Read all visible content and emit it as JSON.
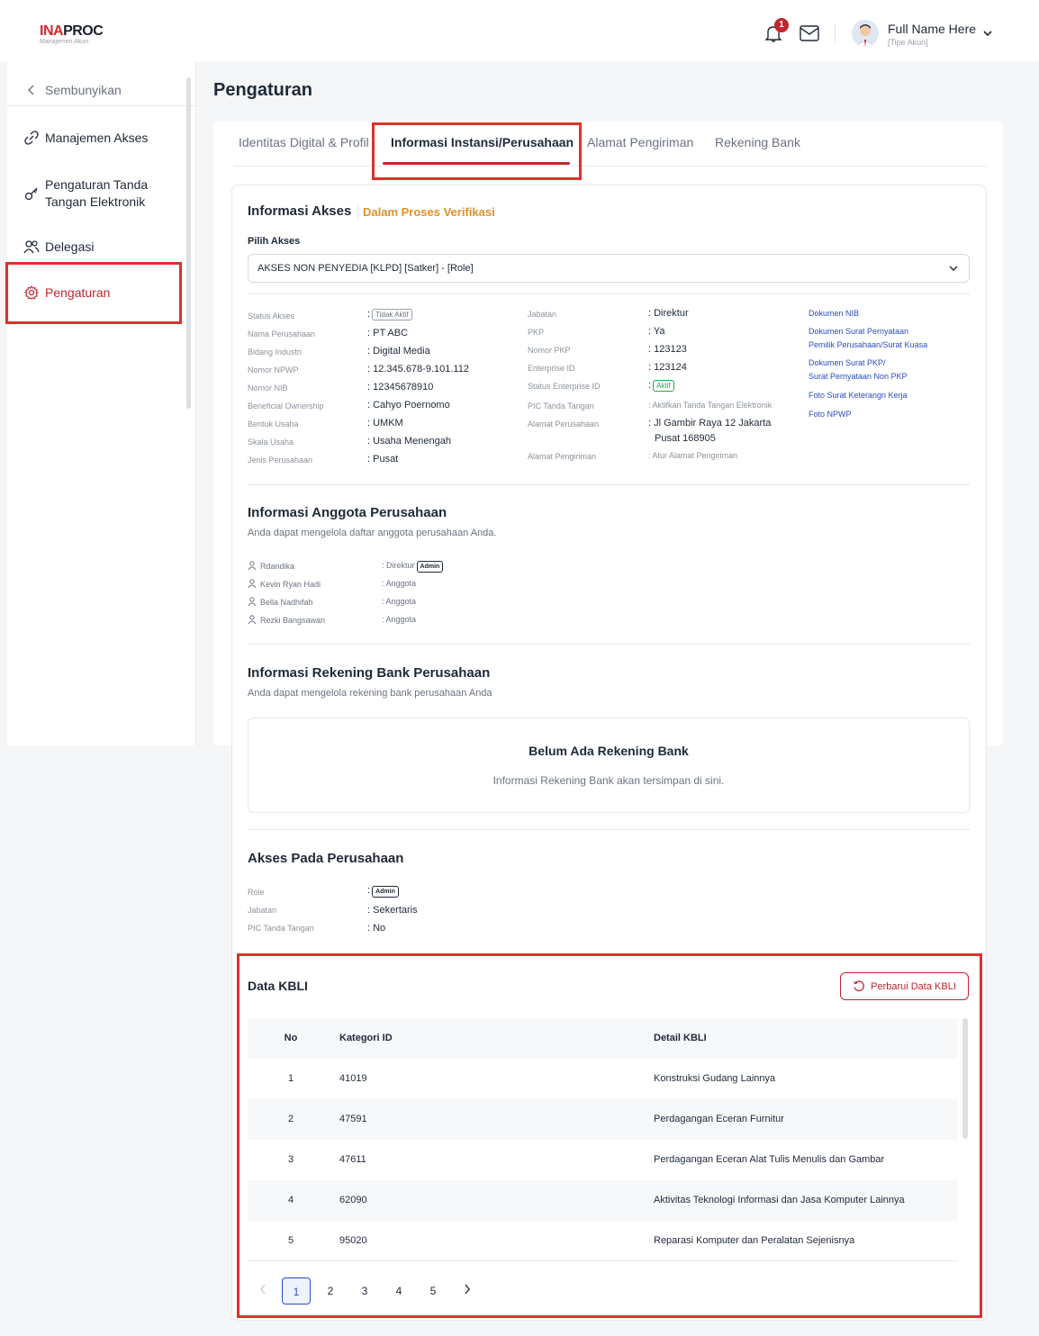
{
  "header": {
    "logo_prefix": "INA",
    "logo_suffix": "PROC",
    "logo_sub": "Manajemen Akun",
    "notif_count": "1",
    "user_name": "Full Name Here",
    "user_role": "[Tipe Akun]"
  },
  "sidebar": {
    "hide_label": "Sembunyikan",
    "items": [
      {
        "label": "Manajemen Akses"
      },
      {
        "label": "Pengaturan Tanda"
      },
      {
        "label": "Tangan Elektronik"
      },
      {
        "label": "Delegasi"
      },
      {
        "label": "Pengaturan"
      }
    ]
  },
  "page": {
    "title": "Pengaturan",
    "tabs": [
      "Identitas Digital & Profil",
      "Informasi Instansi/Perusahaan",
      "Alamat Pengiriman",
      "Rekening Bank"
    ]
  },
  "akses": {
    "title": "Informasi Akses",
    "status": "Dalam Proses Verifikasi",
    "pilih_label": "Pilih Akses",
    "selected": "AKSES NON PENYEDIA [KLPD] [Satker] - [Role]",
    "col1_labels": [
      "Status Akses",
      "Nama Perusahaan",
      "Bidang Industri",
      "Nomor NPWP",
      "Nomor NIB",
      "Beneficial Ownership",
      "Bentuk Usaha",
      "Skala Usaha",
      "Jenis Perusahaan"
    ],
    "col1_values": [
      ":",
      ": PT ABC",
      ": Digital Media",
      ": 12.345.678-9.101.112",
      ": 12345678910",
      ": Cahyo Poernomo",
      ": UMKM",
      ": Usaha Menengah",
      ": Pusat"
    ],
    "status_pill": "Tidak Aktif",
    "col2_labels": [
      "Jabatan",
      "PKP",
      "Nomor PKP",
      "Enterprise ID",
      "Status Enterprise ID",
      "PIC Tanda Tangan",
      "Alamat Perusahaan",
      "Alamat Pengiriman"
    ],
    "col2_values": [
      ": Direktur",
      ": Ya",
      ": 123123",
      ": 123124",
      ":",
      ": Aktifkan Tanda Tangan Elektronik",
      ": Jl Gambir Raya 12 Jakarta",
      "Pusat 168905",
      ": Atur Alamat Pengiriman"
    ],
    "enterprise_pill": "Aktif",
    "docs": [
      "Dokumen NIB",
      "Dokumen Surat Pernyataan",
      "Pemilik Perusahaan/Surat Kuasa",
      "Dokumen Surat PKP/",
      "Surat Pernyataan Non PKP",
      "Foto Surat Keterangn Kerja",
      "Foto NPWP"
    ]
  },
  "anggota": {
    "title": "Informasi Anggota Perusahaan",
    "subtitle": "Anda dapat mengelola daftar anggota perusahaan Anda.",
    "members": [
      {
        "name": "Rdandika",
        "role": ": Direktur",
        "badge": "Admin"
      },
      {
        "name": "Kevin Ryan Hadi",
        "role": ": Anggota"
      },
      {
        "name": "Bella Nadhifah",
        "role": ": Anggota"
      },
      {
        "name": "Rezki Bangsawan",
        "role": ": Anggota"
      }
    ]
  },
  "rekening": {
    "title": "Informasi Rekening Bank Perusahaan",
    "subtitle": "Anda dapat mengelola rekening bank perusahaan Anda",
    "empty_title": "Belum Ada Rekening Bank",
    "empty_sub": "Informasi Rekening Bank akan tersimpan di sini."
  },
  "akses_perusahaan": {
    "title": "Akses Pada Perusahaan",
    "labels": [
      "Role",
      "Jabatan",
      "PIC Tanda Tangan"
    ],
    "role_prefix": ":",
    "role_badge": "Admin",
    "jabatan": ": Sekertaris",
    "pic": ": No"
  },
  "kbli": {
    "title": "Data KBLI",
    "button": "Perbarui Data KBLI",
    "headers": [
      "No",
      "Kategori ID",
      "Detail KBLI"
    ],
    "rows": [
      [
        "1",
        "41019",
        "Konstruksi Gudang Lainnya"
      ],
      [
        "2",
        "47591",
        "Perdagangan Eceran Furnitur"
      ],
      [
        "3",
        "47611",
        "Perdagangan Eceran Alat Tulis Menulis dan Gambar"
      ],
      [
        "4",
        "62090",
        "Aktivitas Teknologi Informasi dan Jasa Komputer Lainnya"
      ],
      [
        "5",
        "95020",
        "Reparasi Komputer dan Peralatan Sejenisnya"
      ]
    ],
    "pages": [
      "1",
      "2",
      "3",
      "4",
      "5"
    ]
  },
  "colors": {
    "accent": "#c0262d",
    "link": "#2a4dbf",
    "highlight": "#e0302b",
    "warning": "#e0902a",
    "success": "#2ba34a"
  },
  "icons": [
    "bell-icon",
    "mail-icon",
    "avatar",
    "chevron-down-icon",
    "chevron-left-icon",
    "link-icon",
    "key-icon",
    "users-icon",
    "gear-icon",
    "user-icon",
    "refresh-icon",
    "chevron-right-icon"
  ]
}
